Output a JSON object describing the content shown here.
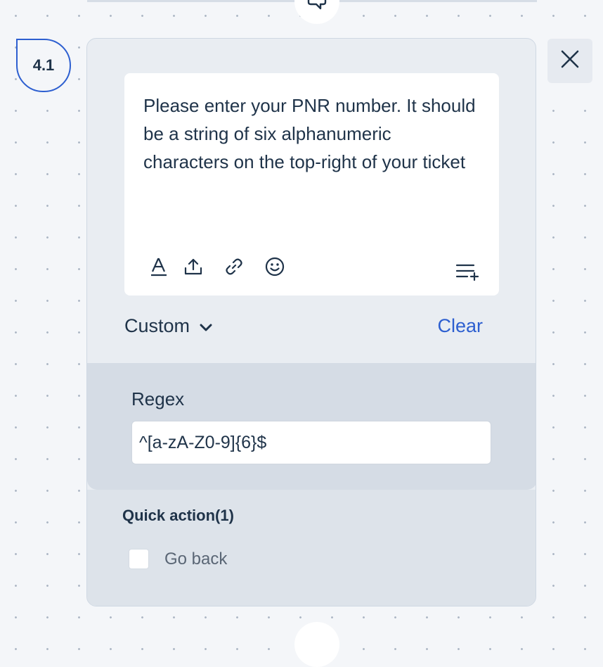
{
  "step": {
    "label": "4.1"
  },
  "message": {
    "text": "Please enter your PNR number. It should be a string of six alphanumeric characters on the top-right of your ticket"
  },
  "toolbar": {
    "icons": [
      "text-format-icon",
      "upload-icon",
      "link-icon",
      "emoji-icon",
      "add-list-icon"
    ]
  },
  "validation": {
    "type_label": "Custom",
    "clear_label": "Clear"
  },
  "regex": {
    "label": "Regex",
    "value": "^[a-zA-Z0-9]{6}$"
  },
  "quick_actions": {
    "title": "Quick action(1)",
    "items": [
      {
        "label": "Go back",
        "checked": false
      }
    ]
  },
  "colors": {
    "accent": "#2d5fd0",
    "text": "#1f3349",
    "card_background": "#e9edf2",
    "regex_panel_background": "#d5dce5",
    "canvas_background": "#f4f6f9"
  }
}
